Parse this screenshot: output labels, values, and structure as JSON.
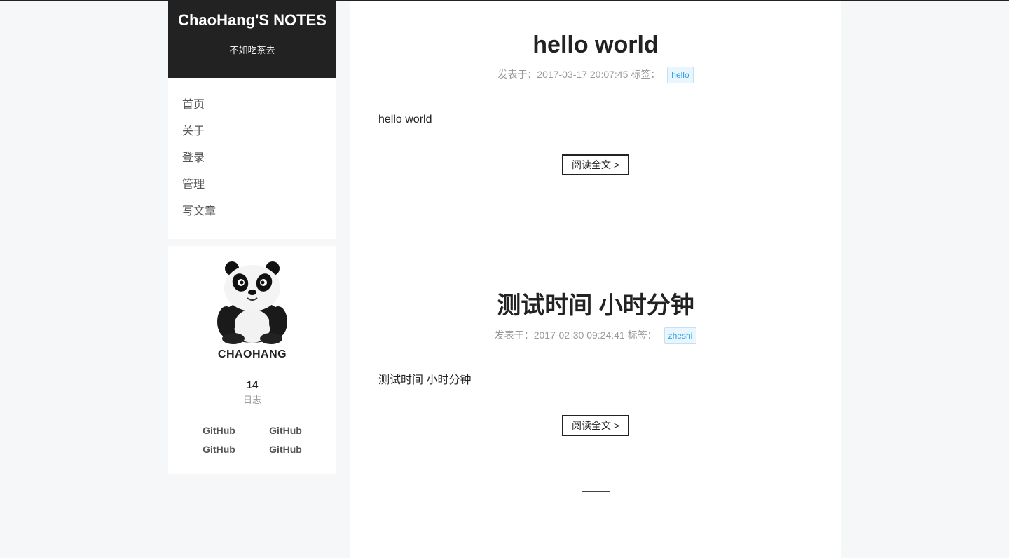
{
  "site": {
    "title": "ChaoHang'S NOTES",
    "subtitle": "不如吃茶去"
  },
  "menu": {
    "items": [
      {
        "label": "首页"
      },
      {
        "label": "关于"
      },
      {
        "label": "登录"
      },
      {
        "label": "管理"
      },
      {
        "label": "写文章"
      }
    ]
  },
  "author": {
    "name": "CHAOHANG",
    "posts_count": "14",
    "posts_label": "日志",
    "links": [
      "GitHub",
      "GitHub",
      "GitHub",
      "GitHub"
    ]
  },
  "posts": [
    {
      "title": "hello world",
      "meta": "发表于：2017-03-17 20:07:45 标签：",
      "tag": "hello",
      "excerpt": "hello world",
      "readmore": "阅读全文 >"
    },
    {
      "title": "测试时间 小时分钟",
      "meta": "发表于：2017-02-30 09:24:41 标签：",
      "tag": "zheshi",
      "excerpt": "测试时间 小时分钟",
      "readmore": "阅读全文 >"
    }
  ],
  "colors": {
    "brand_bg": "#222222",
    "page_bg": "#f5f7f9",
    "tag_text": "#2a9fe0",
    "tag_bg": "#eaf6fd"
  }
}
